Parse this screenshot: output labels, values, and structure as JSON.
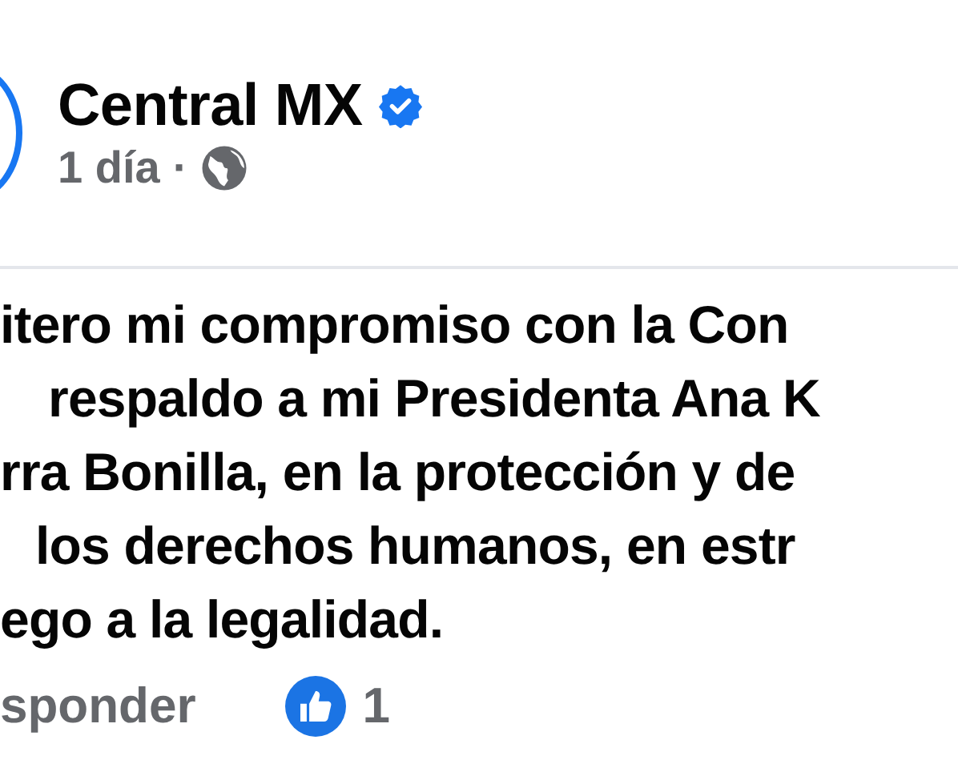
{
  "post": {
    "author": "Central MX",
    "verified": true,
    "time": "1 día",
    "separator": "·"
  },
  "comment": {
    "lines": [
      "itero mi compromiso con la Con",
      "respaldo a mi Presidenta Ana K",
      "rra Bonilla, en la protección y de",
      "los derechos humanos, en estr",
      "ego a la legalidad."
    ],
    "reply": "sponder",
    "reactions": "1"
  }
}
